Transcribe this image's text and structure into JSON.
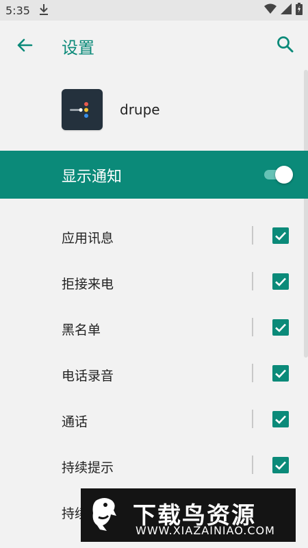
{
  "status_bar": {
    "time": "5:35"
  },
  "header": {
    "title": "设置"
  },
  "app": {
    "name": "drupe"
  },
  "notification": {
    "label": "显示通知",
    "enabled": true
  },
  "settings_items": [
    {
      "label": "应用讯息",
      "checked": true
    },
    {
      "label": "拒接来电",
      "checked": true
    },
    {
      "label": "黑名单",
      "checked": true
    },
    {
      "label": "电话录音",
      "checked": true
    },
    {
      "label": "通话",
      "checked": true
    },
    {
      "label": "持续提示",
      "checked": true
    },
    {
      "label": "持续",
      "checked": true
    }
  ],
  "watermark": {
    "title": "下载鸟资源",
    "url": "WWW.XIAZAINIAO.COM"
  },
  "colors": {
    "accent": "#0b8a79",
    "background": "#f2f2f2",
    "app_icon_bg": "#24313d"
  }
}
